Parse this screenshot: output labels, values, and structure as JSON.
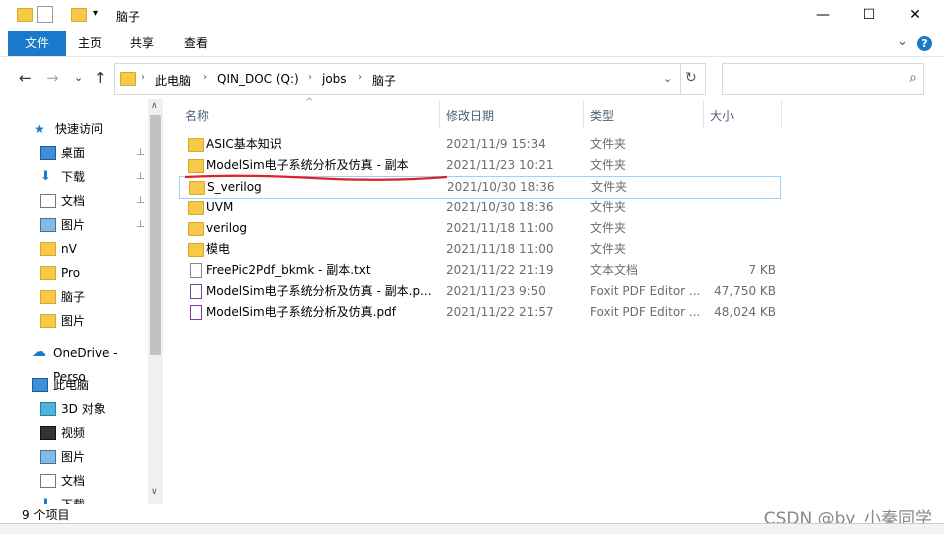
{
  "window": {
    "title": "脑子",
    "controls": {
      "minimize": "—",
      "maximize": "☐",
      "close": "✕"
    }
  },
  "ribbon": {
    "tabs": [
      "文件",
      "主页",
      "共享",
      "查看"
    ],
    "expand": "⌄",
    "help": "?"
  },
  "nav": {
    "back": "←",
    "forward": "→",
    "recent": "⌄",
    "up": "↑",
    "breadcrumb": [
      "此电脑",
      "QIN_DOC (Q:)",
      "jobs",
      "脑子"
    ],
    "addr_dropdown": "⌄",
    "refresh": "↻",
    "search_placeholder": "",
    "search_icon": "⌕"
  },
  "sidebar": {
    "items": [
      {
        "label": "快速访问",
        "icon": "star-icon",
        "pinned": false
      },
      {
        "label": "桌面",
        "icon": "desktop-icon",
        "pinned": true
      },
      {
        "label": "下载",
        "icon": "download-icon",
        "pinned": true
      },
      {
        "label": "文档",
        "icon": "document-icon",
        "pinned": true
      },
      {
        "label": "图片",
        "icon": "pictures-icon",
        "pinned": true
      },
      {
        "label": "nV",
        "icon": "folder-icon",
        "pinned": false
      },
      {
        "label": "Pro",
        "icon": "folder-icon",
        "pinned": false
      },
      {
        "label": "脑子",
        "icon": "folder-icon",
        "pinned": false
      },
      {
        "label": "图片",
        "icon": "folder-icon",
        "pinned": false
      },
      {
        "label": "OneDrive - Perso",
        "icon": "cloud-icon",
        "pinned": false
      },
      {
        "label": "此电脑",
        "icon": "computer-icon",
        "pinned": false
      },
      {
        "label": "3D 对象",
        "icon": "cube-icon",
        "pinned": false
      },
      {
        "label": "视频",
        "icon": "video-icon",
        "pinned": false
      },
      {
        "label": "图片",
        "icon": "pictures-icon",
        "pinned": false
      },
      {
        "label": "文档",
        "icon": "document-icon",
        "pinned": false
      },
      {
        "label": "下载",
        "icon": "download-icon",
        "pinned": false
      }
    ],
    "pin_glyph": "📌"
  },
  "columns": {
    "name": "名称",
    "date": "修改日期",
    "type": "类型",
    "size": "大小",
    "sort_indicator": "^"
  },
  "files": [
    {
      "name": "ASIC基本知识",
      "date": "2021/11/9 15:34",
      "type": "文件夹",
      "size": "",
      "kind": "folder"
    },
    {
      "name": "ModelSim电子系统分析及仿真 - 副本",
      "date": "2021/11/23 10:21",
      "type": "文件夹",
      "size": "",
      "kind": "folder"
    },
    {
      "name": "S_verilog",
      "date": "2021/10/30 18:36",
      "type": "文件夹",
      "size": "",
      "kind": "folder"
    },
    {
      "name": "UVM",
      "date": "2021/10/30 18:36",
      "type": "文件夹",
      "size": "",
      "kind": "folder"
    },
    {
      "name": "verilog",
      "date": "2021/11/18 11:00",
      "type": "文件夹",
      "size": "",
      "kind": "folder"
    },
    {
      "name": "模电",
      "date": "2021/11/18 11:00",
      "type": "文件夹",
      "size": "",
      "kind": "folder"
    },
    {
      "name": "FreePic2Pdf_bkmk - 副本.txt",
      "date": "2021/11/22 21:19",
      "type": "文本文档",
      "size": "7 KB",
      "kind": "txt"
    },
    {
      "name": "ModelSim电子系统分析及仿真 - 副本.p...",
      "date": "2021/11/23 9:50",
      "type": "Foxit PDF Editor ...",
      "size": "47,750 KB",
      "kind": "pdf"
    },
    {
      "name": "ModelSim电子系统分析及仿真.pdf",
      "date": "2021/11/22 21:57",
      "type": "Foxit PDF Editor ...",
      "size": "48,024 KB",
      "kind": "pdf"
    }
  ],
  "status": {
    "count": "9 个项目",
    "watermark": "CSDN @by_小秦同学"
  },
  "colors": {
    "accent": "#1979ca",
    "folder": "#f7c948",
    "selection_border": "#99d1ff",
    "annotation": "#e0202a"
  }
}
